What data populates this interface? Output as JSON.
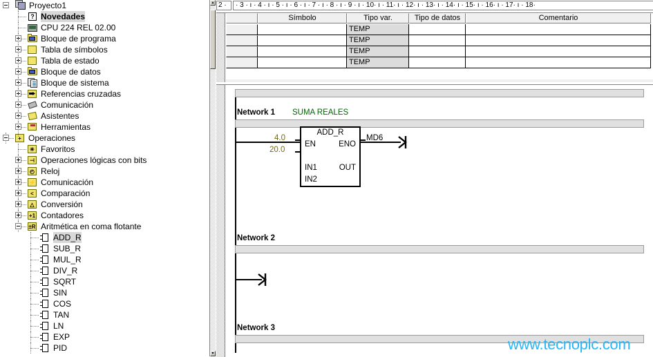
{
  "project_tree": {
    "root": {
      "label": "Proyecto1",
      "icon": "project-icon"
    },
    "items": [
      {
        "label": "Novedades",
        "icon": "help-icon",
        "indent": 1,
        "expander": "none",
        "bold": true,
        "selected": true
      },
      {
        "label": "CPU 224 REL 02.00",
        "icon": "cpu-icon",
        "indent": 1,
        "expander": "none",
        "bold": false,
        "selected": false
      },
      {
        "label": "Bloque de programa",
        "icon": "program-block-icon",
        "indent": 1,
        "expander": "plus",
        "bold": false,
        "selected": false
      },
      {
        "label": "Tabla de símbolos",
        "icon": "symbol-table-icon",
        "indent": 1,
        "expander": "plus",
        "bold": false,
        "selected": false
      },
      {
        "label": "Tabla de estado",
        "icon": "status-table-icon",
        "indent": 1,
        "expander": "plus",
        "bold": false,
        "selected": false
      },
      {
        "label": "Bloque de datos",
        "icon": "data-block-icon",
        "indent": 1,
        "expander": "plus",
        "bold": false,
        "selected": false
      },
      {
        "label": "Bloque de sistema",
        "icon": "system-block-icon",
        "indent": 1,
        "expander": "plus",
        "bold": false,
        "selected": false
      },
      {
        "label": "Referencias cruzadas",
        "icon": "cross-reference-icon",
        "indent": 1,
        "expander": "plus",
        "bold": false,
        "selected": false
      },
      {
        "label": "Comunicación",
        "icon": "communication-icon",
        "indent": 1,
        "expander": "plus",
        "bold": false,
        "selected": false
      },
      {
        "label": "Asistentes",
        "icon": "wizard-icon",
        "indent": 1,
        "expander": "plus",
        "bold": false,
        "selected": false
      },
      {
        "label": "Herramientas",
        "icon": "tools-icon",
        "indent": 1,
        "expander": "plus",
        "bold": false,
        "selected": false
      },
      {
        "label": "Operaciones",
        "icon": "operations-icon",
        "indent": 0,
        "expander": "minus",
        "bold": false,
        "selected": false
      },
      {
        "label": "Favoritos",
        "icon": "favorites-icon",
        "indent": 1,
        "expander": "none",
        "bold": false,
        "selected": false
      },
      {
        "label": "Operaciones lógicas con bits",
        "icon": "bit-logic-icon",
        "indent": 1,
        "expander": "plus",
        "bold": false,
        "selected": false
      },
      {
        "label": "Reloj",
        "icon": "clock-icon",
        "indent": 1,
        "expander": "plus",
        "bold": false,
        "selected": false
      },
      {
        "label": "Comunicación",
        "icon": "communication-folder-icon",
        "indent": 1,
        "expander": "plus",
        "bold": false,
        "selected": false
      },
      {
        "label": "Comparación",
        "icon": "compare-icon",
        "indent": 1,
        "expander": "plus",
        "bold": false,
        "selected": false
      },
      {
        "label": "Conversión",
        "icon": "convert-icon",
        "indent": 1,
        "expander": "plus",
        "bold": false,
        "selected": false
      },
      {
        "label": "Contadores",
        "icon": "counters-icon",
        "indent": 1,
        "expander": "plus",
        "bold": false,
        "selected": false
      },
      {
        "label": "Aritmética en coma flotante",
        "icon": "float-math-icon",
        "indent": 1,
        "expander": "minus",
        "bold": false,
        "selected": false
      },
      {
        "label": "ADD_R",
        "icon": "instruction-icon",
        "indent": 2,
        "expander": "none",
        "bold": false,
        "selected": true
      },
      {
        "label": "SUB_R",
        "icon": "instruction-icon",
        "indent": 2,
        "expander": "none",
        "bold": false,
        "selected": false
      },
      {
        "label": "MUL_R",
        "icon": "instruction-icon",
        "indent": 2,
        "expander": "none",
        "bold": false,
        "selected": false
      },
      {
        "label": "DIV_R",
        "icon": "instruction-icon",
        "indent": 2,
        "expander": "none",
        "bold": false,
        "selected": false
      },
      {
        "label": "SQRT",
        "icon": "instruction-icon",
        "indent": 2,
        "expander": "none",
        "bold": false,
        "selected": false
      },
      {
        "label": "SIN",
        "icon": "instruction-icon",
        "indent": 2,
        "expander": "none",
        "bold": false,
        "selected": false
      },
      {
        "label": "COS",
        "icon": "instruction-icon",
        "indent": 2,
        "expander": "none",
        "bold": false,
        "selected": false
      },
      {
        "label": "TAN",
        "icon": "instruction-icon",
        "indent": 2,
        "expander": "none",
        "bold": false,
        "selected": false
      },
      {
        "label": "LN",
        "icon": "instruction-icon",
        "indent": 2,
        "expander": "none",
        "bold": false,
        "selected": false
      },
      {
        "label": "EXP",
        "icon": "instruction-icon",
        "indent": 2,
        "expander": "none",
        "bold": false,
        "selected": false
      },
      {
        "label": "PID",
        "icon": "instruction-icon",
        "indent": 2,
        "expander": "none",
        "bold": false,
        "selected": false
      }
    ],
    "folder_icon_glyphs": {
      "bit-logic-icon": "⊣",
      "clock-icon": "◴",
      "communication-folder-icon": "⚡",
      "compare-icon": "<",
      "convert-icon": "△",
      "counters-icon": "+1",
      "float-math-icon": "±R",
      "operations-icon": "+",
      "favorites-icon": "✳"
    }
  },
  "ruler": {
    "corner_label": "2 ·",
    "scale": "· 3 · ı · 4 · ı · 5 · ı · 6 · ı · 7 · ı · 8 · ı · 9 · ı · 10· ı · 11· ı · 12· ı · 13· ı · 14· ı · 15· ı · 16· ı · 17· ı · 18·"
  },
  "variable_table": {
    "columns": [
      "",
      "Símbolo",
      "Tipo var.",
      "Tipo de datos",
      "Comentario"
    ],
    "rows": [
      {
        "num": "",
        "simbolo": "",
        "tipo_var": "TEMP",
        "tipo_datos": "",
        "comentario": ""
      },
      {
        "num": "",
        "simbolo": "",
        "tipo_var": "TEMP",
        "tipo_datos": "",
        "comentario": ""
      },
      {
        "num": "",
        "simbolo": "",
        "tipo_var": "TEMP",
        "tipo_datos": "",
        "comentario": ""
      },
      {
        "num": "",
        "simbolo": "",
        "tipo_var": "TEMP",
        "tipo_datos": "",
        "comentario": ""
      }
    ]
  },
  "ladder": {
    "networks": [
      {
        "label": "Network 1",
        "title": "SUMA REALES"
      },
      {
        "label": "Network 2",
        "title": ""
      },
      {
        "label": "Network 3",
        "title": ""
      }
    ],
    "block": {
      "name": "ADD_R",
      "pins_left": [
        "EN",
        "IN1",
        "IN2"
      ],
      "pins_right": [
        "ENO",
        "OUT"
      ],
      "in1_value": "4.0",
      "in2_value": "20.0",
      "out_value": "MD6"
    }
  },
  "watermark": {
    "text": "www.tecnoplc.com"
  },
  "colors": {
    "network_title": "#006600",
    "operand": "#7a6a00",
    "watermark": "#29b6f6",
    "comment_bar": "#e0e0e0",
    "temp_cell": "#dcdcdc",
    "folder": "#f2e36a"
  }
}
